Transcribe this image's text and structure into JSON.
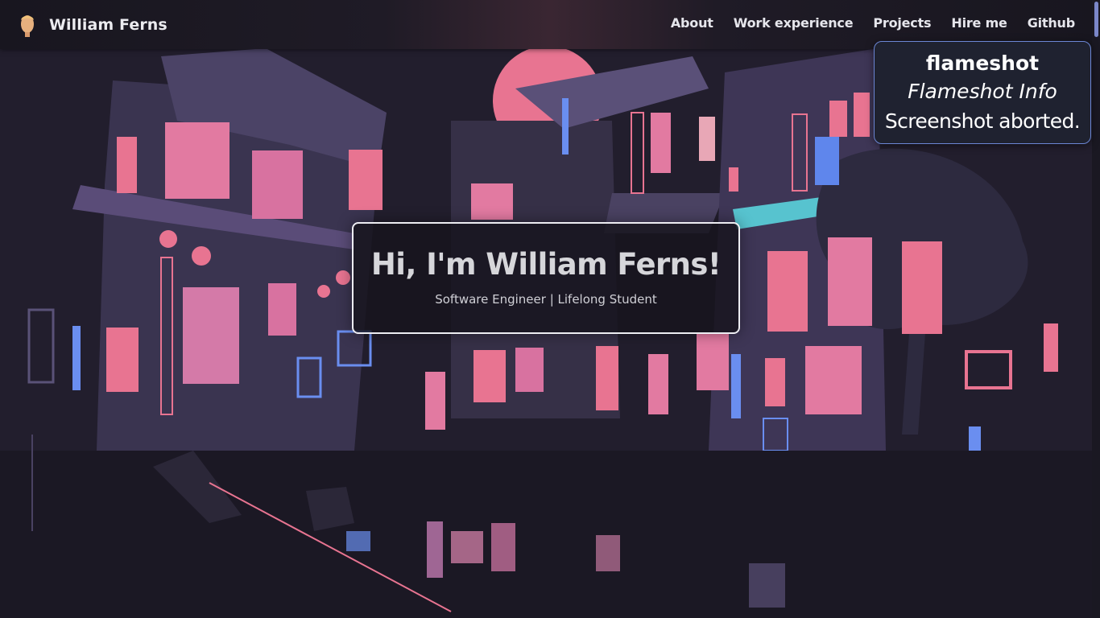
{
  "navbar": {
    "brand_name": "William Ferns",
    "brand_icon": "face-avatar-icon",
    "links": [
      "About",
      "Work experience",
      "Projects",
      "Hire me",
      "Github"
    ]
  },
  "hero": {
    "title": "Hi, I'm William Ferns!",
    "subtitle": "Software Engineer | Lifelong Student"
  },
  "notification": {
    "app_name": "flameshot",
    "summary": "Flameshot Info",
    "body": "Screenshot aborted."
  },
  "colors": {
    "neon_pink": "#e8789a",
    "neon_blue": "#6a8ef0",
    "neon_teal": "#52d6c4",
    "building_purple": "#4a4262",
    "background_dark": "#1c1a26"
  }
}
